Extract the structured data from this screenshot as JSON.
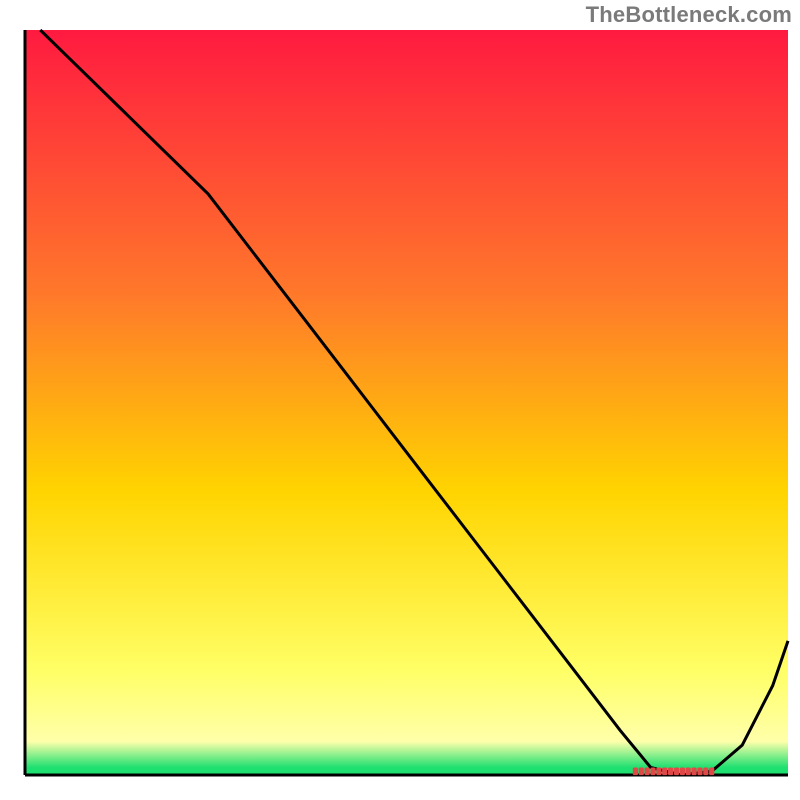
{
  "watermark": "TheBottleneck.com",
  "colors": {
    "gradient_top": "#ff1a40",
    "gradient_mid1": "#ff7a2a",
    "gradient_mid2": "#ffd400",
    "gradient_yellow_pale": "#ffffaa",
    "gradient_green": "#1ee070",
    "line": "#000000",
    "marker": "#e04848",
    "axis": "#000000",
    "bg": "#ffffff"
  },
  "chart_data": {
    "type": "line",
    "title": "",
    "xlabel": "",
    "ylabel": "",
    "xlim": [
      0,
      100
    ],
    "ylim": [
      0,
      100
    ],
    "grid": false,
    "legend": false,
    "series": [
      {
        "name": "bottleneck-curve",
        "x": [
          2,
          6,
          12,
          18,
          24,
          30,
          36,
          42,
          48,
          54,
          60,
          66,
          72,
          78,
          82,
          86,
          90,
          94,
          98,
          100
        ],
        "y": [
          100,
          96,
          90,
          84,
          78,
          70,
          62,
          54,
          46,
          38,
          30,
          22,
          14,
          6,
          1,
          0,
          0.5,
          4,
          12,
          18
        ]
      }
    ],
    "annotations": [
      {
        "name": "optimal-zone-marker",
        "x_range": [
          80,
          90
        ],
        "y": 0.5,
        "style": "dotted-red"
      }
    ]
  }
}
